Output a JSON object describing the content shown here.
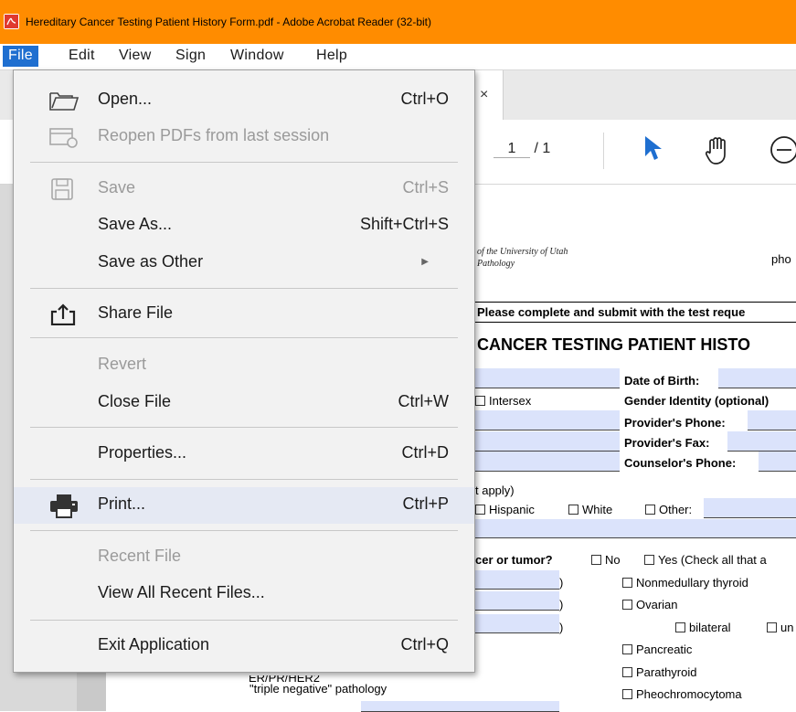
{
  "window": {
    "title": "Hereditary Cancer Testing Patient History Form.pdf - Adobe Acrobat Reader (32-bit)",
    "accent": "#ff8c00"
  },
  "menubar": [
    "File",
    "Edit",
    "View",
    "Sign",
    "Window",
    "Help"
  ],
  "tab": {
    "close": "×"
  },
  "toolbar": {
    "current_page": "1",
    "total_pages": "/ 1"
  },
  "file_menu": {
    "open": {
      "label": "Open...",
      "shortcut": "Ctrl+O"
    },
    "reopen": {
      "label": "Reopen PDFs from last session"
    },
    "save": {
      "label": "Save",
      "shortcut": "Ctrl+S"
    },
    "save_as": {
      "label": "Save As...",
      "shortcut": "Shift+Ctrl+S"
    },
    "save_other": {
      "label": "Save as Other"
    },
    "share": {
      "label": "Share File"
    },
    "revert": {
      "label": "Revert"
    },
    "close": {
      "label": "Close File",
      "shortcut": "Ctrl+W"
    },
    "properties": {
      "label": "Properties...",
      "shortcut": "Ctrl+D"
    },
    "print": {
      "label": "Print...",
      "shortcut": "Ctrl+P"
    },
    "recent": {
      "label": "Recent File"
    },
    "view_recent": {
      "label": "View All Recent Files..."
    },
    "exit": {
      "label": "Exit Application",
      "shortcut": "Ctrl+Q"
    }
  },
  "doc": {
    "univ_line1": "of the University of Utah",
    "univ_line2": "Pathology",
    "pho": "pho",
    "instruction": "Please complete and submit with the test reque",
    "heading": "CANCER TESTING PATIENT HISTO",
    "dob": "Date of Birth:",
    "intersex": "Intersex",
    "gender_identity": "Gender Identity (optional)",
    "provider_phone": "Provider's Phone:",
    "provider_fax": "Provider's Fax:",
    "counselor_phone": "Counselor's Phone:",
    "apply": "t apply)",
    "hispanic": "Hispanic",
    "white": "White",
    "other": "Other:",
    "cancer_q": "cer or tumor?",
    "no": "No",
    "yes": "Yes  (Check all that a",
    "paren": ")",
    "nonmedullary": "Nonmedullary thyroid",
    "ovarian": "Ovarian",
    "bilateral": "bilateral",
    "un": "un",
    "pancreatic": "Pancreatic",
    "parathyroid": "Parathyroid",
    "pheo": "Pheochromocytoma",
    "er_pr": "ER/PR/HER2",
    "triple": "\"triple negative\" pathology"
  }
}
